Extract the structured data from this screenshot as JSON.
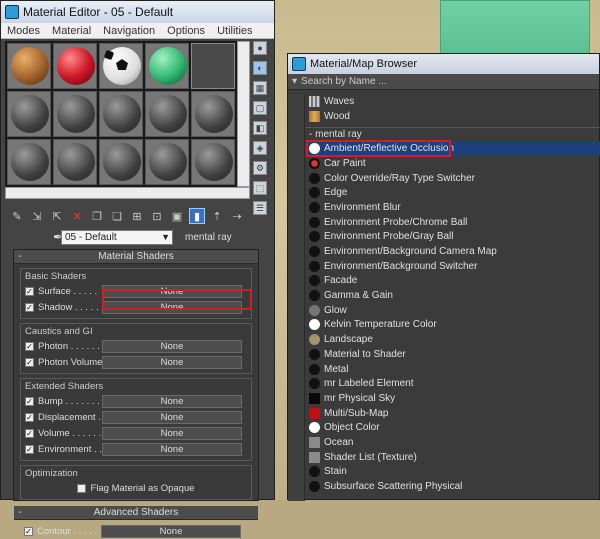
{
  "material_editor": {
    "title": "Material Editor - 05 - Default",
    "menu": [
      "Modes",
      "Material",
      "Navigation",
      "Options",
      "Utilities"
    ],
    "material_name": "05 - Default",
    "material_type": "mental ray",
    "rollout_title": "Material Shaders",
    "advanced_title": "Advanced Shaders",
    "groups": [
      {
        "title": "Basic Shaders",
        "rows": [
          {
            "label": "Surface . . . . .",
            "value": "None"
          },
          {
            "label": "Shadow . . . . .",
            "value": "None"
          }
        ]
      },
      {
        "title": "Caustics and GI",
        "rows": [
          {
            "label": "Photon . . . . . .",
            "value": "None"
          },
          {
            "label": "Photon Volume .",
            "value": "None"
          }
        ]
      },
      {
        "title": "Extended Shaders",
        "rows": [
          {
            "label": "Bump . . . . . . .",
            "value": "None"
          },
          {
            "label": "Displacement . .",
            "value": "None"
          },
          {
            "label": "Volume . . . . . .",
            "value": "None"
          },
          {
            "label": "Environment . . .",
            "value": "None"
          }
        ]
      },
      {
        "title": "Optimization",
        "rows": []
      }
    ],
    "flag_label": "Flag Material as Opaque",
    "contour_label": "Contour . . . . . .",
    "contour_value": "None"
  },
  "material_browser": {
    "title": "Material/Map Browser",
    "search_placeholder": "Search by Name ...",
    "top_items": [
      {
        "label": "Waves",
        "icon": "waves"
      },
      {
        "label": "Wood",
        "icon": "wood"
      }
    ],
    "category": "- mental ray",
    "items": [
      {
        "label": "Ambient/Reflective Occlusion",
        "icon": "white"
      },
      {
        "label": "Car Paint",
        "icon": "carpaint"
      },
      {
        "label": "Color Override/Ray Type Switcher",
        "icon": "black"
      },
      {
        "label": "Edge",
        "icon": "black"
      },
      {
        "label": "Environment Blur",
        "icon": "black"
      },
      {
        "label": "Environment Probe/Chrome Ball",
        "icon": "black"
      },
      {
        "label": "Environment Probe/Gray Ball",
        "icon": "black"
      },
      {
        "label": "Environment/Background Camera Map",
        "icon": "black"
      },
      {
        "label": "Environment/Background Switcher",
        "icon": "black"
      },
      {
        "label": "Facade",
        "icon": "black"
      },
      {
        "label": "Gamma & Gain",
        "icon": "black"
      },
      {
        "label": "Glow",
        "icon": "dkgray"
      },
      {
        "label": "Kelvin Temperature Color",
        "icon": "white"
      },
      {
        "label": "Landscape",
        "icon": "tan"
      },
      {
        "label": "Material to Shader",
        "icon": "black"
      },
      {
        "label": "Metal",
        "icon": "black"
      },
      {
        "label": "mr Labeled Element",
        "icon": "black"
      },
      {
        "label": "mr Physical Sky",
        "icon": "sky"
      },
      {
        "label": "Multi/Sub-Map",
        "icon": "red"
      },
      {
        "label": "Object Color",
        "icon": "white"
      },
      {
        "label": "Ocean",
        "icon": "gray"
      },
      {
        "label": "Shader List (Texture)",
        "icon": "gray"
      },
      {
        "label": "Stain",
        "icon": "black"
      },
      {
        "label": "Subsurface Scattering Physical",
        "icon": "black"
      }
    ]
  },
  "colors": {
    "highlight": "#d51c22",
    "selection": "#1f3f7a"
  }
}
